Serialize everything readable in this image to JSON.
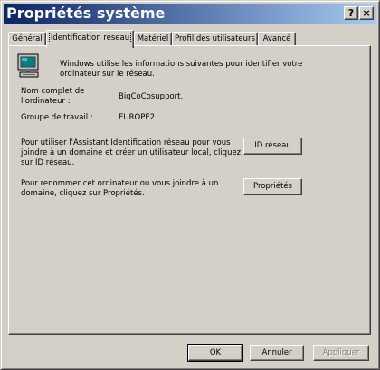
{
  "window": {
    "title": "Propriétés système",
    "help_label": "?",
    "close_label": "×"
  },
  "tabs": [
    {
      "label": "Général",
      "active": false
    },
    {
      "label": "Identification réseau",
      "active": true
    },
    {
      "label": "Matériel",
      "active": false
    },
    {
      "label": "Profil des utilisateurs",
      "active": false
    },
    {
      "label": "Avancé",
      "active": false
    }
  ],
  "identification": {
    "intro_line1": "Windows utilise les informations suivantes pour identifier votre",
    "intro_line2": "ordinateur sur le réseau.",
    "full_name_label_line1": "Nom complet de",
    "full_name_label_line2": "l'ordinateur :",
    "full_name_value": "BigCoCosupport.",
    "workgroup_label": "Groupe de travail :",
    "workgroup_value": "EUROPE2",
    "wizard_text_line1": "Pour utiliser l'Assistant Identification réseau pour vous",
    "wizard_text_line2": "joindre à un domaine et créer un utilisateur local, cliquez",
    "wizard_text_line3": "sur ID réseau.",
    "network_id_button": "ID réseau",
    "rename_text_line1": "Pour renommer cet ordinateur ou vous joindre à un",
    "rename_text_line2": "domaine, cliquez sur Propriétés.",
    "properties_button": "Propriétés"
  },
  "footer": {
    "ok_button": "OK",
    "cancel_button": "Annuler",
    "apply_button": "Appliquer"
  },
  "icons": {
    "computer": "computer-icon"
  }
}
